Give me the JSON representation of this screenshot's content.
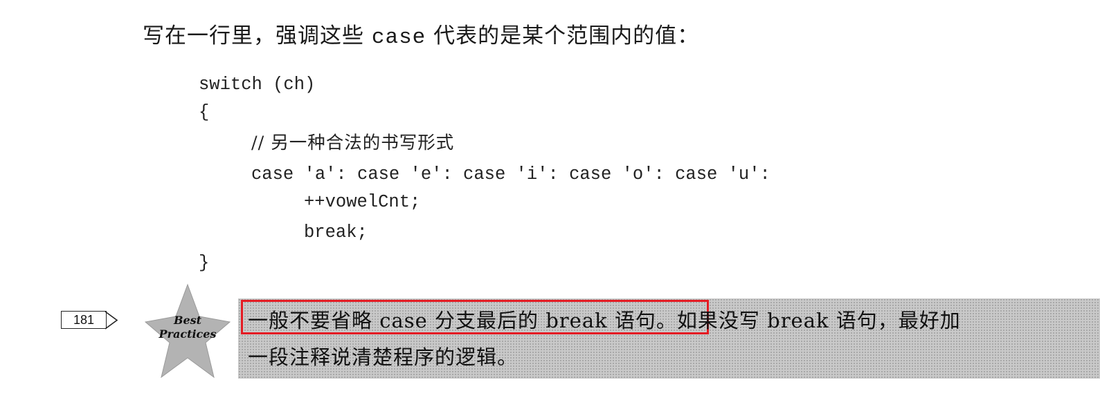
{
  "intro": {
    "part1": "写在一行里，强调这些 ",
    "keyword": "case",
    "part2": " 代表的是某个范围内的值："
  },
  "code": {
    "lines": [
      "switch (ch)",
      "{",
      "// 另一种合法的书写形式",
      "case 'a': case 'e': case 'i': case 'o': case 'u':",
      "++vowelCnt;",
      "break;",
      "}"
    ]
  },
  "margin": {
    "page_number": "181"
  },
  "best_practices": {
    "label_line1": "Best",
    "label_line2": "Practices",
    "icon": "star-badge-icon"
  },
  "tip": {
    "line1_highlighted": "一般不要省略 case 分支最后的 break 语句",
    "line1_rest": "。如果没写 break 语句，最好加",
    "line2": "一段注释说清楚程序的逻辑。"
  },
  "colors": {
    "highlight_border": "#e41b23",
    "tip_background": "#c9c9c9"
  }
}
